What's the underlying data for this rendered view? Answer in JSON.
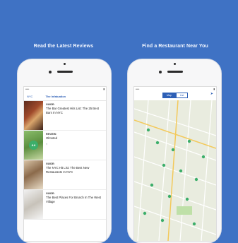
{
  "left_panel": {
    "title": "Read the Latest Reviews",
    "nav": {
      "back_label": "NYC",
      "brand_label": "The Infatuation"
    },
    "feed": [
      {
        "kicker": "GUIDE:",
        "title": "The Bar Greatest Hits List: The 25 Best Bars In NYC",
        "meta": ""
      },
      {
        "kicker": "REVIEW:",
        "title": "Olmsted",
        "meta": ""
      },
      {
        "kicker": "GUIDE:",
        "title": "The NYC Hit List: The Best New Restaurants In NYC",
        "meta": ""
      },
      {
        "kicker": "GUIDE:",
        "title": "The Best Places For Brunch In The West Village",
        "meta": ""
      }
    ],
    "score_badge": "8.8"
  },
  "right_panel": {
    "title": "Find a Restaurant Near You",
    "segmented": {
      "option_1": "Map",
      "option_2": "List"
    }
  },
  "colors": {
    "background": "#3f72c4",
    "accent": "#2d5fb6",
    "pin": "#3cae6a"
  }
}
